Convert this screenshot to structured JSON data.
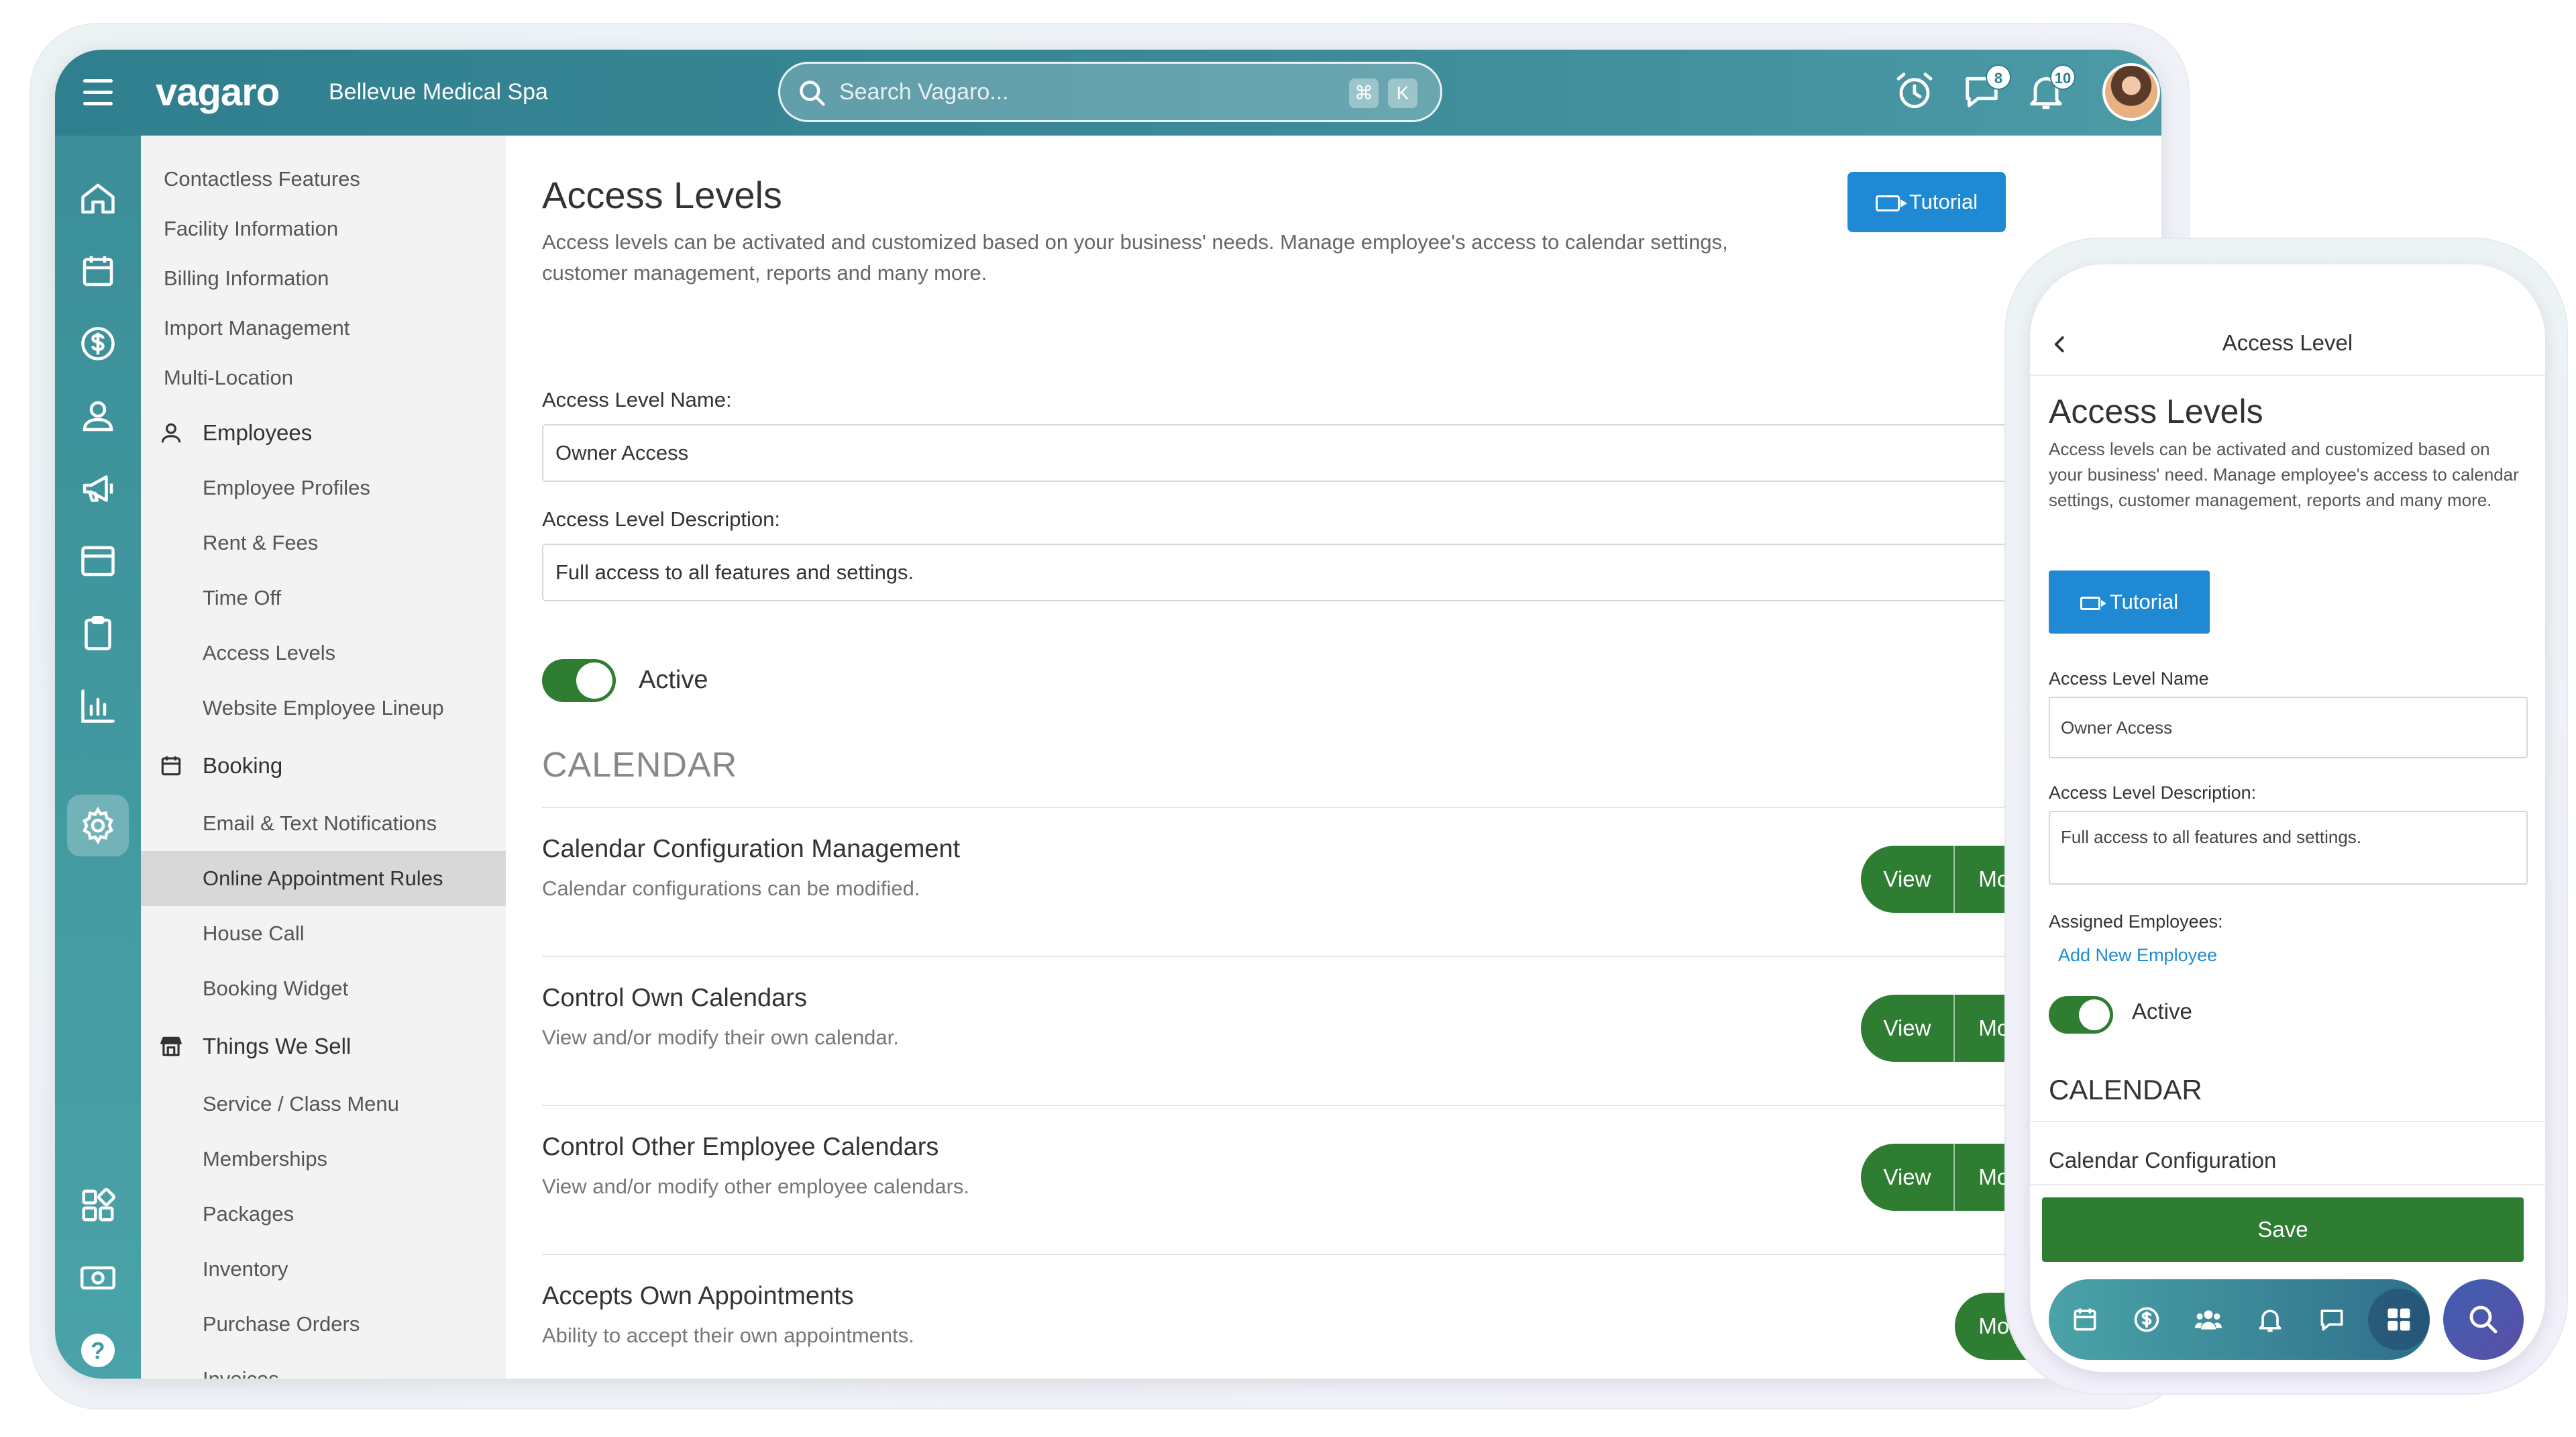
{
  "topbar": {
    "logo": "vagaro",
    "business_name": "Bellevue Medical Spa",
    "search_placeholder": "Search Vagaro...",
    "shortcut_cmd": "⌘",
    "shortcut_key": "K",
    "messages_count": "8",
    "notifications_count": "10"
  },
  "settings_nav": {
    "items": [
      {
        "label": "Contactless Features"
      },
      {
        "label": "Facility Information"
      },
      {
        "label": "Billing Information"
      },
      {
        "label": "Import Management"
      },
      {
        "label": "Multi-Location"
      }
    ],
    "employees": {
      "label": "Employees",
      "items": [
        "Employee Profiles",
        "Rent & Fees",
        "Time Off",
        "Access Levels",
        "Website Employee Lineup"
      ]
    },
    "booking": {
      "label": "Booking",
      "items": [
        "Email & Text Notifications",
        "Online Appointment Rules",
        "House Call",
        "Booking Widget"
      ]
    },
    "things_we_sell": {
      "label": "Things We Sell",
      "items": [
        "Service / Class Menu",
        "Memberships",
        "Packages",
        "Inventory",
        "Purchase Orders",
        "Invoices"
      ]
    }
  },
  "main": {
    "title": "Access Levels",
    "description": "Access levels can be activated and customized based on your business' needs. Manage employee's access to calendar settings, customer management, reports and many more.",
    "tutorial_label": "Tutorial",
    "name_label": "Access Level Name:",
    "name_value": "Owner Access",
    "description_label": "Access Level Description:",
    "description_value": "Full access to all features and settings.",
    "active_label": "Active",
    "calendar_heading": "CALENDAR",
    "permissions": [
      {
        "title": "Calendar Configuration Management",
        "desc": "Calendar configurations can be modified.",
        "view": "View",
        "modify": "Modify"
      },
      {
        "title": "Control Own Calendars",
        "desc": "View and/or modify their own calendar.",
        "view": "View",
        "modify": "Modify"
      },
      {
        "title": "Control Other Employee Calendars",
        "desc": "View and/or modify other employee calendars.",
        "view": "View",
        "modify": "Modify"
      },
      {
        "title": "Accepts Own Appointments",
        "desc": "Ability to accept their own appointments.",
        "modify": "Modify"
      }
    ]
  },
  "phone": {
    "header": "Access Level",
    "title": "Access Levels",
    "description": "Access levels can be activated and customized based on your business' need. Manage employee's access to calendar settings, customer management, reports and many more.",
    "tutorial_label": "Tutorial",
    "name_label": "Access Level Name",
    "name_value": "Owner Access",
    "description_label": "Access Level Description:",
    "description_value": "Full access to all features and settings.",
    "assigned_label": "Assigned Employees:",
    "add_employee_link": "Add New Employee",
    "active_label": "Active",
    "calendar_heading": "CALENDAR",
    "calendar_item": "Calendar Configuration",
    "save_label": "Save"
  },
  "colors": {
    "brand_teal": "#2f7f8f",
    "primary_blue": "#1f8ad3",
    "success_green": "#2e7d32"
  },
  "icons": [
    "menu-icon",
    "home-icon",
    "calendar-icon",
    "dollar-icon",
    "user-icon",
    "megaphone-icon",
    "browser-icon",
    "clipboard-icon",
    "chart-icon",
    "gear-icon",
    "apps-icon",
    "money-icon",
    "help-icon",
    "search-icon",
    "alarm-icon",
    "chat-icon",
    "bell-icon"
  ]
}
